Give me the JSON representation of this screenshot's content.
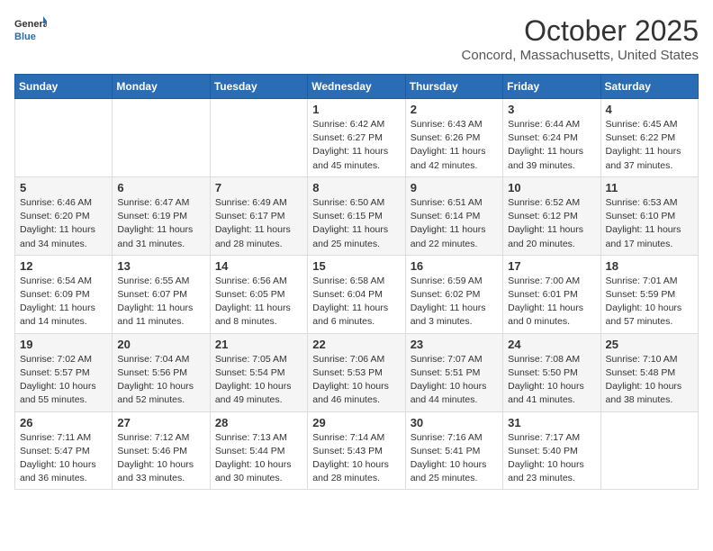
{
  "header": {
    "logo_general": "General",
    "logo_blue": "Blue",
    "month": "October 2025",
    "location": "Concord, Massachusetts, United States"
  },
  "weekdays": [
    "Sunday",
    "Monday",
    "Tuesday",
    "Wednesday",
    "Thursday",
    "Friday",
    "Saturday"
  ],
  "weeks": [
    [
      {
        "day": "",
        "info": ""
      },
      {
        "day": "",
        "info": ""
      },
      {
        "day": "",
        "info": ""
      },
      {
        "day": "1",
        "info": "Sunrise: 6:42 AM\nSunset: 6:27 PM\nDaylight: 11 hours\nand 45 minutes."
      },
      {
        "day": "2",
        "info": "Sunrise: 6:43 AM\nSunset: 6:26 PM\nDaylight: 11 hours\nand 42 minutes."
      },
      {
        "day": "3",
        "info": "Sunrise: 6:44 AM\nSunset: 6:24 PM\nDaylight: 11 hours\nand 39 minutes."
      },
      {
        "day": "4",
        "info": "Sunrise: 6:45 AM\nSunset: 6:22 PM\nDaylight: 11 hours\nand 37 minutes."
      }
    ],
    [
      {
        "day": "5",
        "info": "Sunrise: 6:46 AM\nSunset: 6:20 PM\nDaylight: 11 hours\nand 34 minutes."
      },
      {
        "day": "6",
        "info": "Sunrise: 6:47 AM\nSunset: 6:19 PM\nDaylight: 11 hours\nand 31 minutes."
      },
      {
        "day": "7",
        "info": "Sunrise: 6:49 AM\nSunset: 6:17 PM\nDaylight: 11 hours\nand 28 minutes."
      },
      {
        "day": "8",
        "info": "Sunrise: 6:50 AM\nSunset: 6:15 PM\nDaylight: 11 hours\nand 25 minutes."
      },
      {
        "day": "9",
        "info": "Sunrise: 6:51 AM\nSunset: 6:14 PM\nDaylight: 11 hours\nand 22 minutes."
      },
      {
        "day": "10",
        "info": "Sunrise: 6:52 AM\nSunset: 6:12 PM\nDaylight: 11 hours\nand 20 minutes."
      },
      {
        "day": "11",
        "info": "Sunrise: 6:53 AM\nSunset: 6:10 PM\nDaylight: 11 hours\nand 17 minutes."
      }
    ],
    [
      {
        "day": "12",
        "info": "Sunrise: 6:54 AM\nSunset: 6:09 PM\nDaylight: 11 hours\nand 14 minutes."
      },
      {
        "day": "13",
        "info": "Sunrise: 6:55 AM\nSunset: 6:07 PM\nDaylight: 11 hours\nand 11 minutes."
      },
      {
        "day": "14",
        "info": "Sunrise: 6:56 AM\nSunset: 6:05 PM\nDaylight: 11 hours\nand 8 minutes."
      },
      {
        "day": "15",
        "info": "Sunrise: 6:58 AM\nSunset: 6:04 PM\nDaylight: 11 hours\nand 6 minutes."
      },
      {
        "day": "16",
        "info": "Sunrise: 6:59 AM\nSunset: 6:02 PM\nDaylight: 11 hours\nand 3 minutes."
      },
      {
        "day": "17",
        "info": "Sunrise: 7:00 AM\nSunset: 6:01 PM\nDaylight: 11 hours\nand 0 minutes."
      },
      {
        "day": "18",
        "info": "Sunrise: 7:01 AM\nSunset: 5:59 PM\nDaylight: 10 hours\nand 57 minutes."
      }
    ],
    [
      {
        "day": "19",
        "info": "Sunrise: 7:02 AM\nSunset: 5:57 PM\nDaylight: 10 hours\nand 55 minutes."
      },
      {
        "day": "20",
        "info": "Sunrise: 7:04 AM\nSunset: 5:56 PM\nDaylight: 10 hours\nand 52 minutes."
      },
      {
        "day": "21",
        "info": "Sunrise: 7:05 AM\nSunset: 5:54 PM\nDaylight: 10 hours\nand 49 minutes."
      },
      {
        "day": "22",
        "info": "Sunrise: 7:06 AM\nSunset: 5:53 PM\nDaylight: 10 hours\nand 46 minutes."
      },
      {
        "day": "23",
        "info": "Sunrise: 7:07 AM\nSunset: 5:51 PM\nDaylight: 10 hours\nand 44 minutes."
      },
      {
        "day": "24",
        "info": "Sunrise: 7:08 AM\nSunset: 5:50 PM\nDaylight: 10 hours\nand 41 minutes."
      },
      {
        "day": "25",
        "info": "Sunrise: 7:10 AM\nSunset: 5:48 PM\nDaylight: 10 hours\nand 38 minutes."
      }
    ],
    [
      {
        "day": "26",
        "info": "Sunrise: 7:11 AM\nSunset: 5:47 PM\nDaylight: 10 hours\nand 36 minutes."
      },
      {
        "day": "27",
        "info": "Sunrise: 7:12 AM\nSunset: 5:46 PM\nDaylight: 10 hours\nand 33 minutes."
      },
      {
        "day": "28",
        "info": "Sunrise: 7:13 AM\nSunset: 5:44 PM\nDaylight: 10 hours\nand 30 minutes."
      },
      {
        "day": "29",
        "info": "Sunrise: 7:14 AM\nSunset: 5:43 PM\nDaylight: 10 hours\nand 28 minutes."
      },
      {
        "day": "30",
        "info": "Sunrise: 7:16 AM\nSunset: 5:41 PM\nDaylight: 10 hours\nand 25 minutes."
      },
      {
        "day": "31",
        "info": "Sunrise: 7:17 AM\nSunset: 5:40 PM\nDaylight: 10 hours\nand 23 minutes."
      },
      {
        "day": "",
        "info": ""
      }
    ]
  ]
}
